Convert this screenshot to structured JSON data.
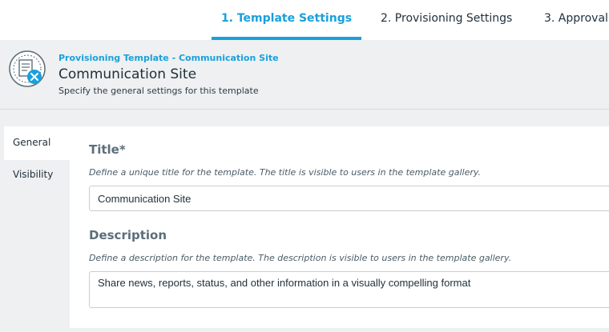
{
  "steps": [
    {
      "label": "1. Template Settings",
      "active": true
    },
    {
      "label": "2. Provisioning Settings",
      "active": false
    },
    {
      "label": "3. Approval",
      "active": false
    }
  ],
  "header": {
    "breadcrumb": "Provisioning Template - Communication Site",
    "title": "Communication Site",
    "subtitle": "Specify the general settings for this template",
    "icon": "site-settings-icon"
  },
  "sidenav": {
    "items": [
      {
        "label": "General",
        "active": true
      },
      {
        "label": "Visibility",
        "active": false
      }
    ]
  },
  "form": {
    "title_field": {
      "label": "Title*",
      "help": "Define a unique title for the template. The title is visible to users in the template gallery.",
      "value": "Communication Site"
    },
    "description_field": {
      "label": "Description",
      "help": "Define a description for the template. The description is visible to users in the template gallery.",
      "value": "Share news, reports, status, and other information in a visually compelling format"
    }
  },
  "colors": {
    "accent": "#1aa0dc",
    "badge": "#1aa0dc",
    "background": "#eef0f1"
  }
}
